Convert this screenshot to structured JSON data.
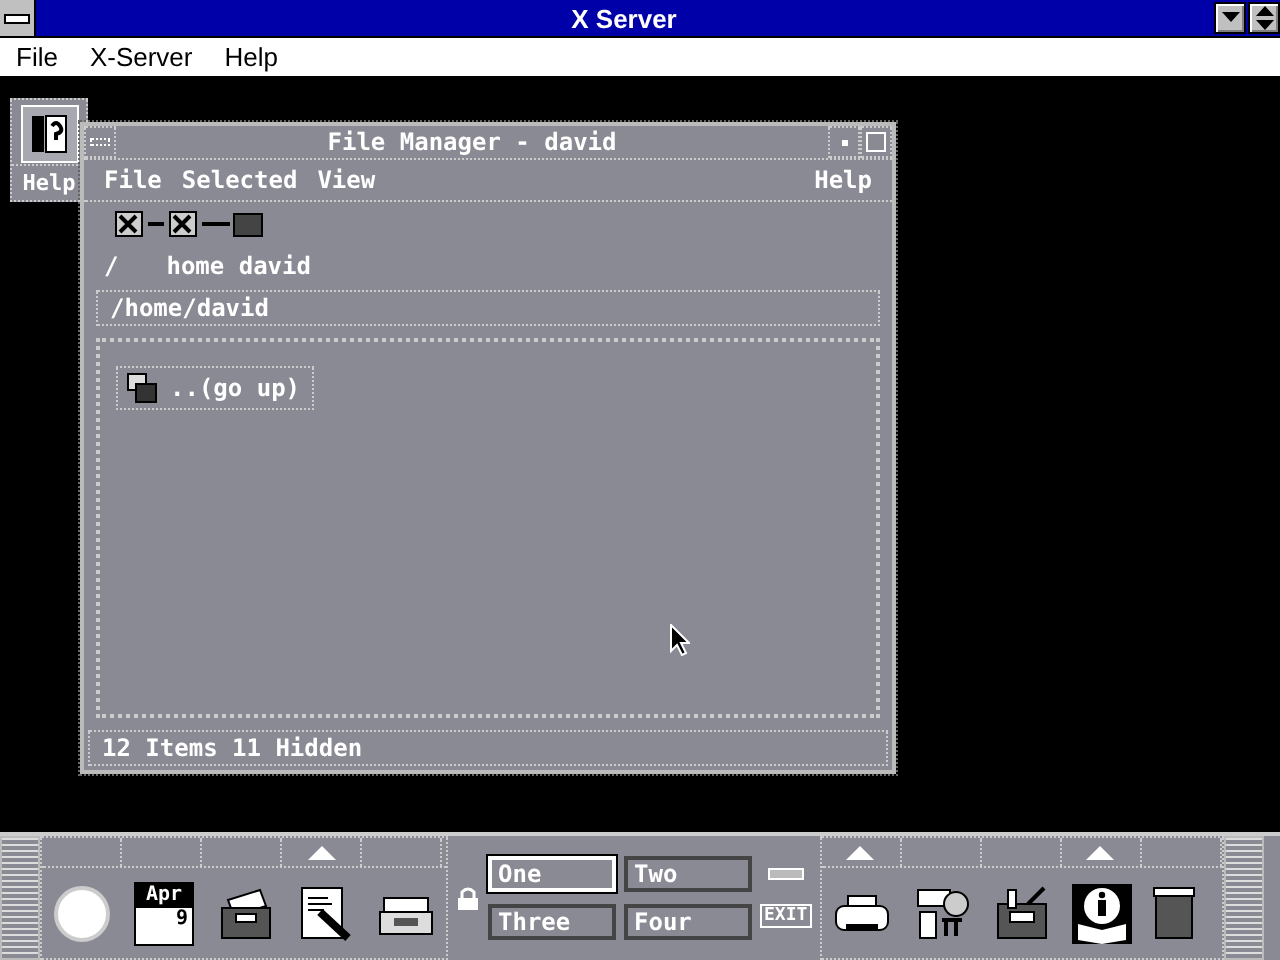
{
  "window": {
    "title": "X Server"
  },
  "menu": [
    "File",
    "X-Server",
    "Help"
  ],
  "help_icon": {
    "label": "Help"
  },
  "file_manager": {
    "title": "File Manager - david",
    "menu_left": [
      "File",
      "Selected",
      "View"
    ],
    "menu_right": "Help",
    "path_labels": [
      "/",
      "home david"
    ],
    "path_field": "/home/david",
    "items": [
      {
        "label": "..(go up)"
      }
    ],
    "status": "12 Items 11 Hidden"
  },
  "front_panel": {
    "left_slots": [
      {
        "kind": "clock",
        "arrow": false
      },
      {
        "kind": "calendar",
        "arrow": false,
        "month": "Apr",
        "day": "9"
      },
      {
        "kind": "files",
        "arrow": false
      },
      {
        "kind": "editor",
        "arrow": true
      },
      {
        "kind": "mail",
        "arrow": false
      }
    ],
    "workspaces": [
      {
        "label": "One",
        "selected": true
      },
      {
        "label": "Two",
        "selected": false
      },
      {
        "label": "Three",
        "selected": false
      },
      {
        "label": "Four",
        "selected": false
      }
    ],
    "exit": "EXIT",
    "right_slots": [
      {
        "kind": "printer",
        "arrow": true
      },
      {
        "kind": "style",
        "arrow": false
      },
      {
        "kind": "apps",
        "arrow": false
      },
      {
        "kind": "info",
        "arrow": true
      },
      {
        "kind": "trash",
        "arrow": false
      }
    ]
  }
}
